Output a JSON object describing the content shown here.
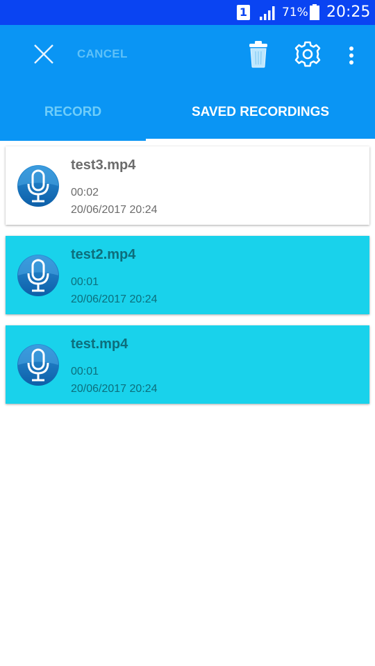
{
  "status_bar": {
    "sim_label": "1",
    "battery_percent": "71%",
    "time": "20:25"
  },
  "app_bar": {
    "cancel_label": "CANCEL",
    "icons": [
      "close-icon",
      "trash-icon",
      "gear-icon",
      "more-vert-icon"
    ]
  },
  "tabs": [
    {
      "label": "RECORD",
      "selected": false
    },
    {
      "label": "SAVED RECORDINGS",
      "selected": true
    }
  ],
  "recordings": [
    {
      "name": "test3.mp4",
      "duration": "00:02",
      "date": "20/06/2017 20:24",
      "highlighted": false
    },
    {
      "name": "test2.mp4",
      "duration": "00:01",
      "date": "20/06/2017 20:24",
      "highlighted": true
    },
    {
      "name": "test.mp4",
      "duration": "00:01",
      "date": "20/06/2017 20:24",
      "highlighted": true
    }
  ],
  "colors": {
    "status_bar": "#0a44f2",
    "app_bar": "#0a95f4",
    "highlight_card": "#19d2eb",
    "mic_blue": "#1576c4"
  }
}
